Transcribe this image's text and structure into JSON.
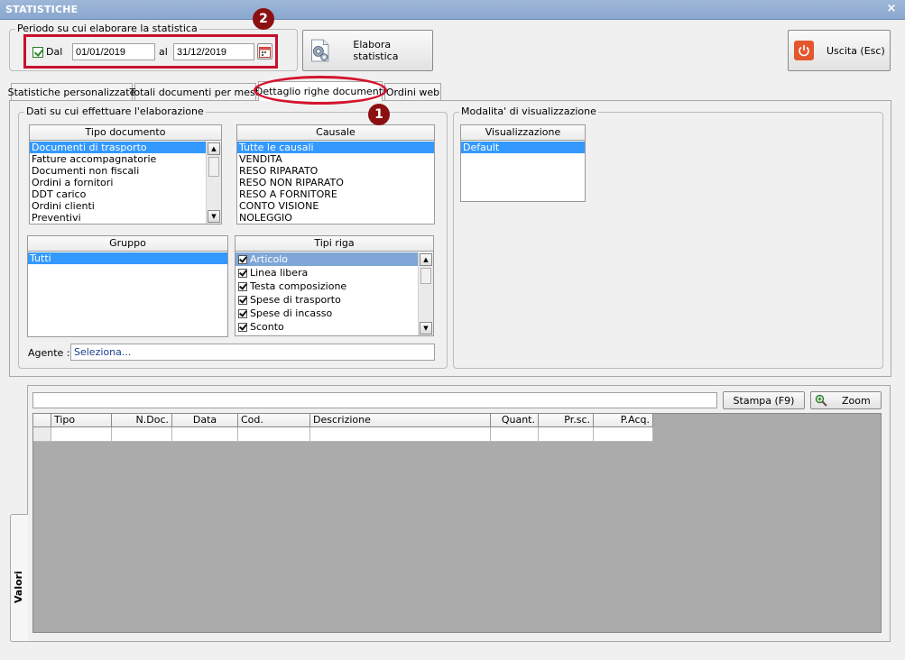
{
  "window": {
    "title": "STATISTICHE",
    "close": "×"
  },
  "period": {
    "legend": "Periodo su cui elaborare la statistica",
    "dal_checked": true,
    "dal_label": "Dal",
    "from": "01/01/2019",
    "al_label": "al",
    "to": "31/12/2019"
  },
  "badges": {
    "one": "1",
    "two": "2"
  },
  "toolbar": {
    "elabora": "Elabora statistica",
    "uscita": "Uscita (Esc)"
  },
  "tabs": [
    {
      "label": "Statistiche personalizzate",
      "active": false
    },
    {
      "label": "Totali documenti per mese",
      "active": false
    },
    {
      "label": "Dettaglio righe documenti",
      "active": true
    },
    {
      "label": "Ordini web",
      "active": false
    }
  ],
  "dati": {
    "legend": "Dati su cui effettuare l'elaborazione",
    "tipo_documento": {
      "header": "Tipo documento",
      "items": [
        "Documenti di trasporto",
        "Fatture accompagnatorie",
        "Documenti non fiscali",
        "Ordini a fornitori",
        "DDT carico",
        "Ordini clienti",
        "Preventivi"
      ]
    },
    "causale": {
      "header": "Causale",
      "items": [
        "Tutte le causali",
        "VENDITA",
        "RESO RIPARATO",
        "RESO NON RIPARATO",
        "RESO A FORNITORE",
        "CONTO VISIONE",
        "NOLEGGIO"
      ]
    },
    "gruppo": {
      "header": "Gruppo",
      "items": [
        "Tutti"
      ]
    },
    "tipi_riga": {
      "header": "Tipi riga",
      "items": [
        "Articolo",
        "Linea libera",
        "Testa composizione",
        "Spese di trasporto",
        "Spese di incasso",
        "Sconto"
      ]
    },
    "agente_label": "Agente :",
    "agente_value": "Seleziona..."
  },
  "modalita": {
    "legend": "Modalita' di visualizzazione",
    "header": "Visualizzazione",
    "items": [
      "Default"
    ]
  },
  "valori": {
    "side_tab": "Valori",
    "stampa": "Stampa (F9)",
    "zoom": "Zoom",
    "columns": [
      "Tipo",
      "N.Doc.",
      "Data",
      "Cod.",
      "Descrizione",
      "Quant.",
      "Pr.sc.",
      "P.Acq."
    ]
  },
  "colors": {
    "accent": "#3399ff",
    "highlight": "#c8102e",
    "badge": "#8c0f12",
    "grid_bg": "#ababab"
  }
}
